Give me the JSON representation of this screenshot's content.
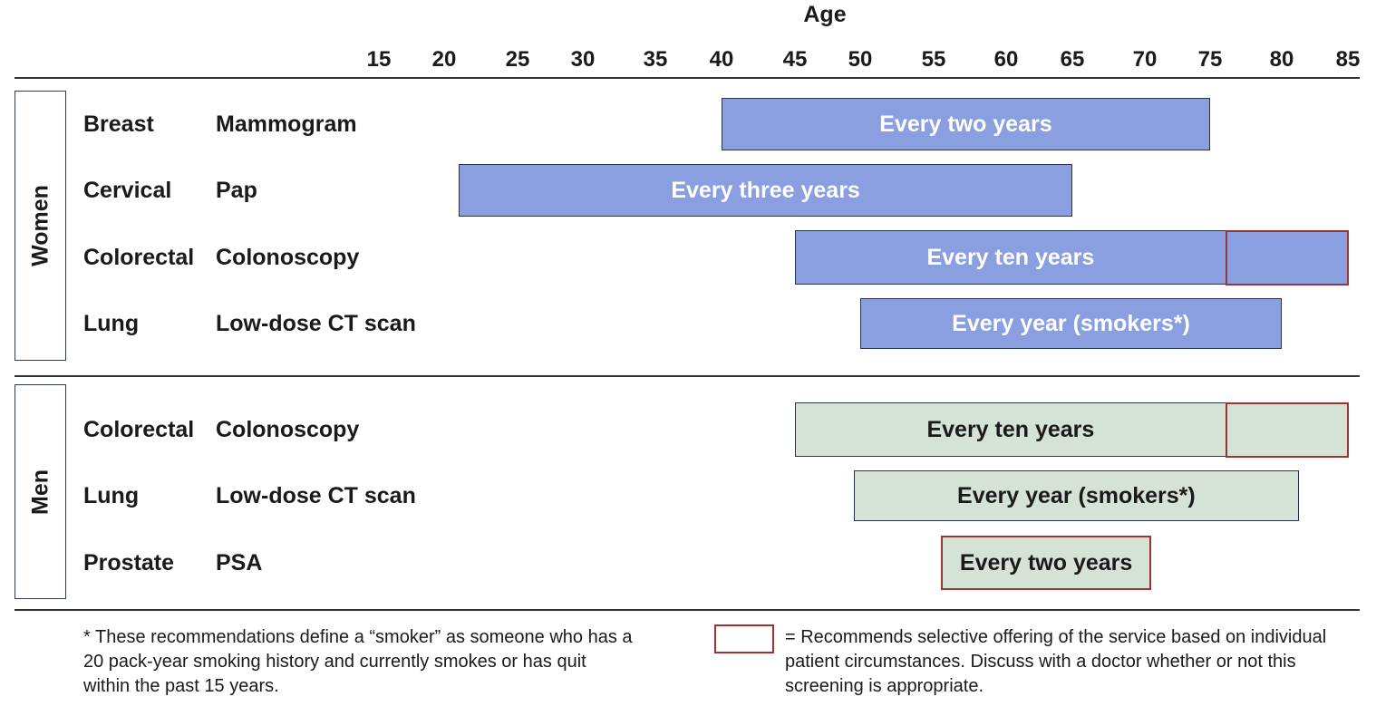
{
  "chart_data": {
    "type": "bar",
    "subtype": "horizontal-range-gantt",
    "title": "",
    "xlabel": "Age",
    "x_ticks": [
      15,
      20,
      25,
      30,
      35,
      40,
      45,
      50,
      55,
      60,
      65,
      70,
      75,
      80,
      85
    ],
    "xlim": [
      15,
      85
    ],
    "legend": {
      "placement": "bottom-right",
      "swatch_meaning": "= Recommends selective offering of the service based on individual patient circumstances. Discuss with a doctor whether or not this screening is appropriate."
    },
    "footnote": "* These recommendations define a “smoker” as someone who has a 20 pack-year smoking history and currently smokes or has quit within the past 15 years.",
    "groups": [
      {
        "name": "Women",
        "color": "#8a9fe0",
        "text_color": "#ffffff",
        "rows": [
          {
            "cancer": "Breast",
            "test": "Mammogram",
            "start": 40,
            "end": 75,
            "label": "Every two years",
            "selective_from": null
          },
          {
            "cancer": "Cervical",
            "test": "Pap",
            "start": 21,
            "end": 65,
            "label": "Every three years",
            "selective_from": null
          },
          {
            "cancer": "Colorectal",
            "test": "Colonoscopy",
            "start": 45,
            "end": 85,
            "label": "Every ten years",
            "selective_from": 76
          },
          {
            "cancer": "Lung",
            "test": "Low-dose CT scan",
            "start": 50,
            "end": 80,
            "label": "Every year (smokers*)",
            "selective_from": null
          }
        ]
      },
      {
        "name": "Men",
        "color": "#d4e3d6",
        "text_color": "#1a1a1a",
        "rows": [
          {
            "cancer": "Colorectal",
            "test": "Colonoscopy",
            "start": 45,
            "end": 85,
            "label": "Every ten years",
            "selective_from": 76
          },
          {
            "cancer": "Lung",
            "test": "Low-dose CT scan",
            "start": 49.5,
            "end": 81.3,
            "label": "Every year (smokers*)",
            "selective_from": null
          },
          {
            "cancer": "Prostate",
            "test": "PSA",
            "start": 55.5,
            "end": 70.5,
            "label": "Every two years",
            "selective_from": 55.5
          }
        ]
      }
    ],
    "selective_border_color": "#9b3334"
  }
}
